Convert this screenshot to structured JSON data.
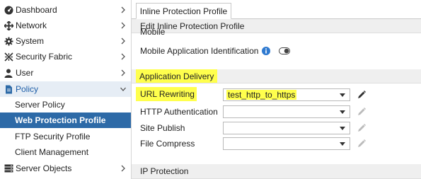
{
  "sidebar": {
    "items": [
      {
        "label": "Dashboard",
        "icon": "dashboard-icon"
      },
      {
        "label": "Network",
        "icon": "network-icon"
      },
      {
        "label": "System",
        "icon": "gear-icon"
      },
      {
        "label": "Security Fabric",
        "icon": "security-fabric-icon"
      },
      {
        "label": "User",
        "icon": "user-icon"
      },
      {
        "label": "Policy",
        "icon": "policy-icon"
      },
      {
        "label": "Server Policy"
      },
      {
        "label": "Web Protection Profile"
      },
      {
        "label": "FTP Security Profile"
      },
      {
        "label": "Client Management"
      },
      {
        "label": "Server Objects",
        "icon": "server-objects-icon"
      }
    ]
  },
  "tabs": [
    {
      "label": "Inline Protection Profile"
    }
  ],
  "main": {
    "edit_header": "Edit Inline Protection Profile",
    "mobile_section": "Mobile",
    "mobile_app_id": {
      "label": "Mobile Application Identification",
      "toggle": "off"
    },
    "app_delivery": {
      "title": "Application Delivery",
      "rows": [
        {
          "label": "URL Rewriting",
          "value": "test_http_to_https"
        },
        {
          "label": "HTTP Authentication",
          "value": ""
        },
        {
          "label": "Site Publish",
          "value": ""
        },
        {
          "label": "File Compress",
          "value": ""
        }
      ]
    },
    "ip_protection": "IP Protection"
  },
  "colors": {
    "accent": "#2d6aa7",
    "highlight": "#ffff4d",
    "policy_bg": "#e6edf5",
    "info": "#2f7ad0"
  }
}
